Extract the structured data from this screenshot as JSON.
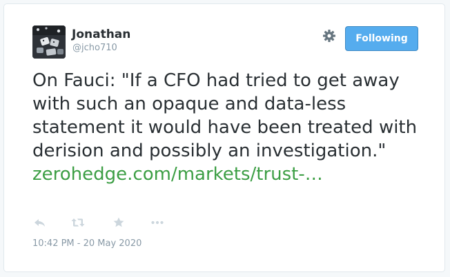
{
  "author": {
    "name": "Jonathan",
    "handle": "@jcho710"
  },
  "header": {
    "follow_label": "Following"
  },
  "tweet": {
    "text": "On Fauci: \"If a CFO had tried to get away with such an opaque and data-less statement it would have been treated with derision and possibly an investigation.\"",
    "link_text": "zerohedge.com/markets/trust-…",
    "timestamp": "10:42 PM - 20 May 2020"
  },
  "actions": [
    "reply-icon",
    "retweet-icon",
    "like-icon",
    "more-icon"
  ],
  "colors": {
    "follow_button": "#55acee",
    "link": "#3c9e44",
    "text": "#292f33",
    "muted": "#8899a6",
    "action_icon": "#ccd6dd"
  }
}
